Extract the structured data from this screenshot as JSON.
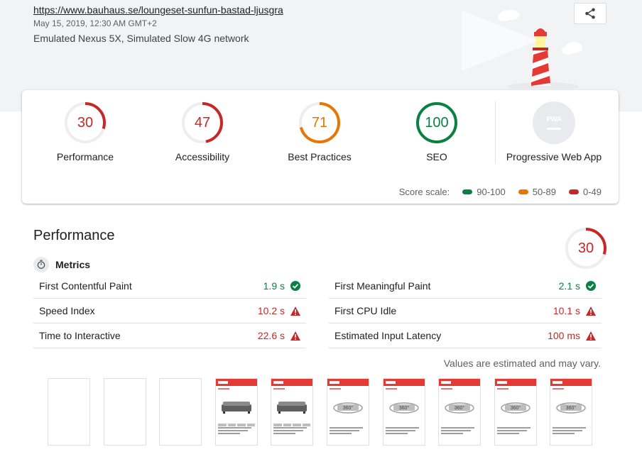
{
  "header": {
    "url": "https://www.bauhaus.se/loungeset-sunfun-bastad-ljusgra",
    "date": "May 15, 2019, 12:30 AM GMT+2",
    "device": "Emulated Nexus 5X, Simulated Slow 4G network",
    "share_icon": "share-icon"
  },
  "scores": [
    {
      "label": "Performance",
      "score": "30",
      "value": 30,
      "color": "#c62828"
    },
    {
      "label": "Accessibility",
      "score": "47",
      "value": 47,
      "color": "#c62828"
    },
    {
      "label": "Best Practices",
      "score": "71",
      "value": 71,
      "color": "#e67700"
    },
    {
      "label": "SEO",
      "score": "100",
      "value": 100,
      "color": "#0b8043"
    }
  ],
  "pwa": {
    "label": "Progressive Web App",
    "badge": "PWA"
  },
  "scale": {
    "label": "Score scale:",
    "items": [
      {
        "range": "90-100",
        "color": "#0b8043"
      },
      {
        "range": "50-89",
        "color": "#e67700"
      },
      {
        "range": "0-49",
        "color": "#c62828"
      }
    ]
  },
  "performance": {
    "title": "Performance",
    "score": "30",
    "value": 30,
    "color": "#c62828",
    "metrics_title": "Metrics",
    "metrics": [
      {
        "name": "First Contentful Paint",
        "value": "1.9 s",
        "status": "pass",
        "color": "#0b8043"
      },
      {
        "name": "First Meaningful Paint",
        "value": "2.1 s",
        "status": "pass",
        "color": "#0b8043"
      },
      {
        "name": "Speed Index",
        "value": "10.2 s",
        "status": "fail",
        "color": "#c62828"
      },
      {
        "name": "First CPU Idle",
        "value": "10.1 s",
        "status": "fail",
        "color": "#c62828"
      },
      {
        "name": "Time to Interactive",
        "value": "22.6 s",
        "status": "fail",
        "color": "#c62828"
      },
      {
        "name": "Estimated Input Latency",
        "value": "100 ms",
        "status": "fail",
        "color": "#c62828"
      }
    ],
    "note": "Values are estimated and may vary."
  },
  "filmstrip": [
    {
      "content": "blank"
    },
    {
      "content": "blank"
    },
    {
      "content": "blank"
    },
    {
      "content": "sofa"
    },
    {
      "content": "sofa"
    },
    {
      "content": "360"
    },
    {
      "content": "360"
    },
    {
      "content": "360"
    },
    {
      "content": "360"
    },
    {
      "content": "360"
    }
  ]
}
